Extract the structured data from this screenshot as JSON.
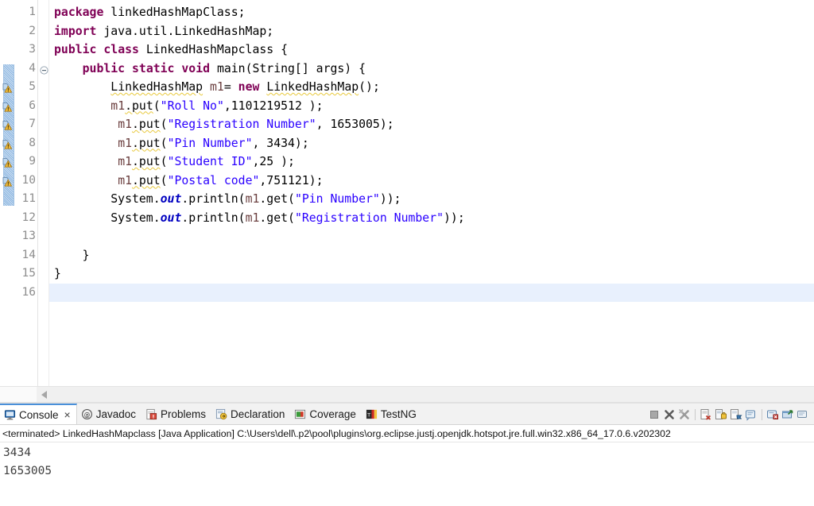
{
  "editor": {
    "current_line": 16,
    "lines": [
      {
        "n": 1,
        "fold": false,
        "warn": false,
        "tokens": [
          {
            "t": "package",
            "c": "kw"
          },
          {
            "t": " linkedHashMapClass;",
            "c": "pln"
          }
        ]
      },
      {
        "n": 2,
        "fold": false,
        "warn": false,
        "tokens": [
          {
            "t": "import",
            "c": "kw"
          },
          {
            "t": " java.util.LinkedHashMap;",
            "c": "pln"
          }
        ]
      },
      {
        "n": 3,
        "fold": false,
        "warn": false,
        "tokens": [
          {
            "t": "public",
            "c": "kw"
          },
          {
            "t": " ",
            "c": "pln"
          },
          {
            "t": "class",
            "c": "kw"
          },
          {
            "t": " LinkedHashMapclass {",
            "c": "pln"
          }
        ]
      },
      {
        "n": 4,
        "fold": true,
        "warn": false,
        "tokens": [
          {
            "t": "    ",
            "c": "pln"
          },
          {
            "t": "public",
            "c": "kw"
          },
          {
            "t": " ",
            "c": "pln"
          },
          {
            "t": "static",
            "c": "kw"
          },
          {
            "t": " ",
            "c": "pln"
          },
          {
            "t": "void",
            "c": "kw"
          },
          {
            "t": " main(String[] args) {",
            "c": "pln"
          }
        ]
      },
      {
        "n": 5,
        "fold": false,
        "warn": true,
        "tokens": [
          {
            "t": "        ",
            "c": "pln"
          },
          {
            "t": "LinkedHashMap",
            "c": "pln",
            "sq": true
          },
          {
            "t": " ",
            "c": "pln"
          },
          {
            "t": "m1",
            "c": "loc"
          },
          {
            "t": "= ",
            "c": "pln"
          },
          {
            "t": "new",
            "c": "kw"
          },
          {
            "t": " ",
            "c": "pln"
          },
          {
            "t": "LinkedHashMap",
            "c": "pln",
            "sq": true
          },
          {
            "t": "();",
            "c": "pln"
          }
        ]
      },
      {
        "n": 6,
        "fold": false,
        "warn": true,
        "tokens": [
          {
            "t": "        ",
            "c": "pln"
          },
          {
            "t": "m1",
            "c": "loc"
          },
          {
            "t": ".put",
            "c": "pln",
            "sq": true
          },
          {
            "t": "(",
            "c": "pln"
          },
          {
            "t": "\"Roll No\"",
            "c": "str"
          },
          {
            "t": ",1101219512 );",
            "c": "pln"
          }
        ]
      },
      {
        "n": 7,
        "fold": false,
        "warn": true,
        "tokens": [
          {
            "t": "         ",
            "c": "pln"
          },
          {
            "t": "m1",
            "c": "loc"
          },
          {
            "t": ".put",
            "c": "pln",
            "sq": true
          },
          {
            "t": "(",
            "c": "pln"
          },
          {
            "t": "\"Registration Number\"",
            "c": "str"
          },
          {
            "t": ", 1653005);",
            "c": "pln"
          }
        ]
      },
      {
        "n": 8,
        "fold": false,
        "warn": true,
        "tokens": [
          {
            "t": "         ",
            "c": "pln"
          },
          {
            "t": "m1",
            "c": "loc"
          },
          {
            "t": ".put",
            "c": "pln",
            "sq": true
          },
          {
            "t": "(",
            "c": "pln"
          },
          {
            "t": "\"Pin Number\"",
            "c": "str"
          },
          {
            "t": ", 3434);",
            "c": "pln"
          }
        ]
      },
      {
        "n": 9,
        "fold": false,
        "warn": true,
        "tokens": [
          {
            "t": "         ",
            "c": "pln"
          },
          {
            "t": "m1",
            "c": "loc"
          },
          {
            "t": ".put",
            "c": "pln",
            "sq": true
          },
          {
            "t": "(",
            "c": "pln"
          },
          {
            "t": "\"Student ID\"",
            "c": "str"
          },
          {
            "t": ",25 );",
            "c": "pln"
          }
        ]
      },
      {
        "n": 10,
        "fold": false,
        "warn": true,
        "tokens": [
          {
            "t": "         ",
            "c": "pln"
          },
          {
            "t": "m1",
            "c": "loc"
          },
          {
            "t": ".put",
            "c": "pln",
            "sq": true
          },
          {
            "t": "(",
            "c": "pln"
          },
          {
            "t": "\"Postal code\"",
            "c": "str"
          },
          {
            "t": ",751121);",
            "c": "pln"
          }
        ]
      },
      {
        "n": 11,
        "fold": false,
        "warn": false,
        "tokens": [
          {
            "t": "        System.",
            "c": "pln"
          },
          {
            "t": "out",
            "c": "fld"
          },
          {
            "t": ".println(",
            "c": "pln"
          },
          {
            "t": "m1",
            "c": "loc"
          },
          {
            "t": ".get(",
            "c": "pln"
          },
          {
            "t": "\"Pin Number\"",
            "c": "str"
          },
          {
            "t": "));",
            "c": "pln"
          }
        ]
      },
      {
        "n": 12,
        "fold": false,
        "warn": false,
        "tokens": [
          {
            "t": "        System.",
            "c": "pln"
          },
          {
            "t": "out",
            "c": "fld"
          },
          {
            "t": ".println(",
            "c": "pln"
          },
          {
            "t": "m1",
            "c": "loc"
          },
          {
            "t": ".get(",
            "c": "pln"
          },
          {
            "t": "\"Registration Number\"",
            "c": "str"
          },
          {
            "t": "));",
            "c": "pln"
          }
        ]
      },
      {
        "n": 13,
        "fold": false,
        "warn": false,
        "tokens": []
      },
      {
        "n": 14,
        "fold": false,
        "warn": false,
        "tokens": [
          {
            "t": "    }",
            "c": "pln"
          }
        ]
      },
      {
        "n": 15,
        "fold": false,
        "warn": false,
        "tokens": [
          {
            "t": "}",
            "c": "pln"
          }
        ]
      },
      {
        "n": 16,
        "fold": false,
        "warn": false,
        "tokens": []
      }
    ],
    "scrollbar": {
      "left_arrow": "scroll-left"
    }
  },
  "console": {
    "tabs": [
      {
        "label": "Console",
        "icon": "console-icon",
        "active": true,
        "closable": true
      },
      {
        "label": "Javadoc",
        "icon": "javadoc-icon",
        "active": false,
        "closable": false
      },
      {
        "label": "Problems",
        "icon": "problems-icon",
        "active": false,
        "closable": false
      },
      {
        "label": "Declaration",
        "icon": "declaration-icon",
        "active": false,
        "closable": false
      },
      {
        "label": "Coverage",
        "icon": "coverage-icon",
        "active": false,
        "closable": false
      },
      {
        "label": "TestNG",
        "icon": "testng-icon",
        "active": false,
        "closable": false
      }
    ],
    "close_glyph": "×",
    "toolbar_icons": [
      "terminate-icon",
      "remove-launch-icon",
      "remove-all-terminated-icon",
      "clear-console-icon",
      "scroll-lock-icon",
      "pin-console-icon",
      "display-selected-console-icon",
      "open-console-icon",
      "new-console-view-icon",
      "console-menu-icon"
    ],
    "status_line": "<terminated> LinkedHashMapclass [Java Application] C:\\Users\\dell\\.p2\\pool\\plugins\\org.eclipse.justj.openjdk.hotspot.jre.full.win32.x86_64_17.0.6.v202302",
    "output": [
      "3434",
      "1653005"
    ]
  },
  "colors": {
    "keyword": "#7F0055",
    "string": "#2A00FF",
    "field": "#0000C0",
    "local_var": "#6A3E3E",
    "plain": "#000000",
    "line_number": "#8E8E8E",
    "current_line_highlight": "#E8F0FD",
    "warning_squiggle": "#E8C93C",
    "tab_active_accent": "#4A90D9",
    "panel_bg": "#F2F2F2"
  }
}
